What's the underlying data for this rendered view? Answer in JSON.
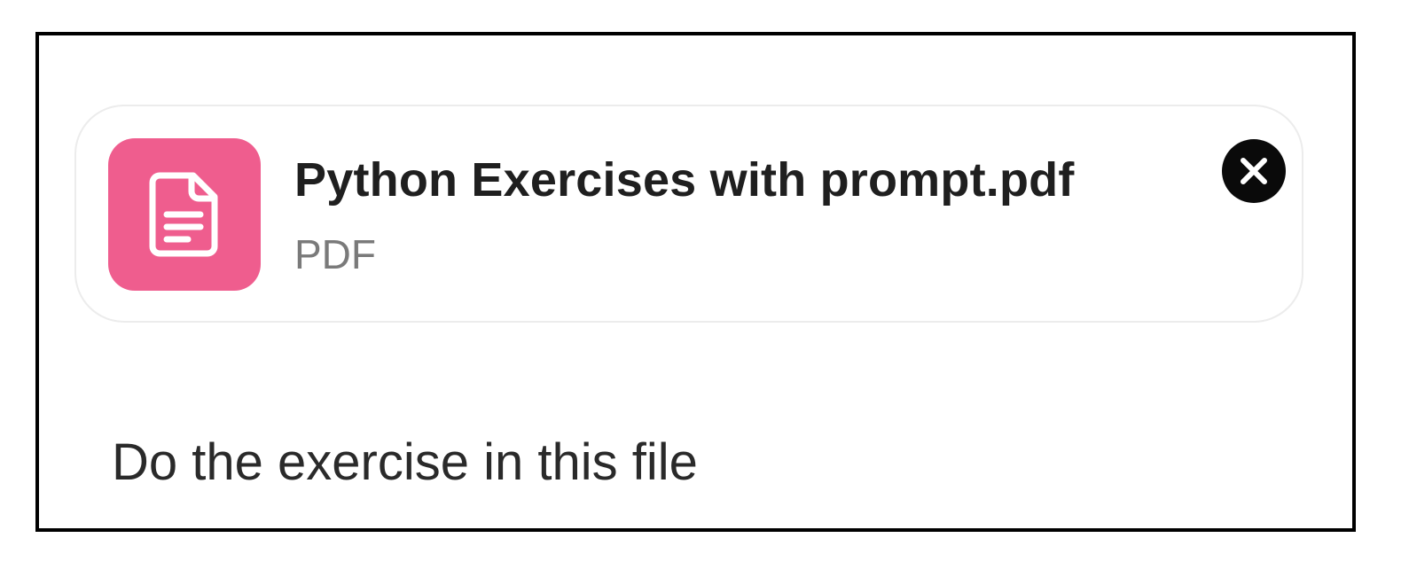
{
  "attachment": {
    "file_name": "Python Exercises with prompt.pdf",
    "file_type": "PDF",
    "icon": "document-icon",
    "icon_color": "#ef5d8e",
    "remove_icon": "close-icon"
  },
  "message": {
    "text": "Do the exercise in this file"
  }
}
